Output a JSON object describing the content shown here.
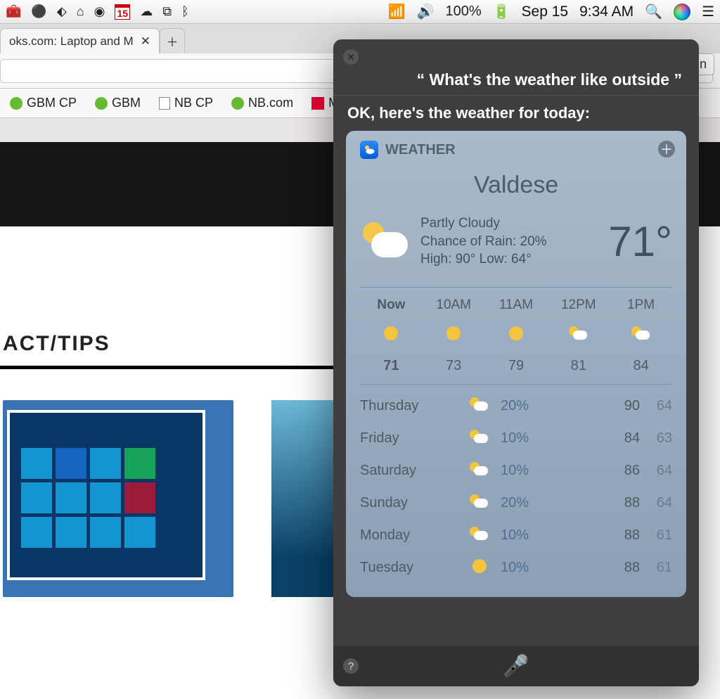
{
  "menubar": {
    "tray_icons": [
      "toolbox",
      "record",
      "dropbox",
      "home",
      "creative-cloud",
      "calendar-15",
      "onedrive",
      "1password",
      "bluetooth",
      "wifi",
      "volume"
    ],
    "calendar_day": "15",
    "battery_text": "100%",
    "date_text": "Sep 15",
    "time_text": "9:34 AM"
  },
  "browser": {
    "tab_title": "oks.com: Laptop and M",
    "profile_button": "Kevin",
    "bookmarks": [
      {
        "icon": "green",
        "label": "GBM CP"
      },
      {
        "icon": "green",
        "label": "GBM"
      },
      {
        "icon": "doc",
        "label": "NB CP"
      },
      {
        "icon": "green",
        "label": "NB.com"
      },
      {
        "icon": "office",
        "label": "M"
      }
    ],
    "page_heading": "ACT/TIPS"
  },
  "siri": {
    "query": "What's the weather like outside",
    "answer": "OK, here's the weather for today:",
    "card": {
      "app_label": "WEATHER",
      "location": "Valdese",
      "condition": "Partly Cloudy",
      "rain_label": "Chance of Rain: 20%",
      "hilo_label": "High: 90°  Low: 64°",
      "current_temp": "71°",
      "hourly": [
        {
          "time": "Now",
          "icon": "sun",
          "temp": "71",
          "current": true
        },
        {
          "time": "10AM",
          "icon": "sun",
          "temp": "73"
        },
        {
          "time": "11AM",
          "icon": "sun",
          "temp": "79"
        },
        {
          "time": "12PM",
          "icon": "partly",
          "temp": "81"
        },
        {
          "time": "1PM",
          "icon": "partly",
          "temp": "84"
        }
      ],
      "daily": [
        {
          "day": "Thursday",
          "icon": "partly",
          "pct": "20%",
          "hi": "90",
          "lo": "64"
        },
        {
          "day": "Friday",
          "icon": "partly",
          "pct": "10%",
          "hi": "84",
          "lo": "63"
        },
        {
          "day": "Saturday",
          "icon": "partly",
          "pct": "10%",
          "hi": "86",
          "lo": "64"
        },
        {
          "day": "Sunday",
          "icon": "partly",
          "pct": "20%",
          "hi": "88",
          "lo": "64"
        },
        {
          "day": "Monday",
          "icon": "partly",
          "pct": "10%",
          "hi": "88",
          "lo": "61"
        },
        {
          "day": "Tuesday",
          "icon": "sun",
          "pct": "10%",
          "hi": "88",
          "lo": "61"
        }
      ]
    }
  }
}
